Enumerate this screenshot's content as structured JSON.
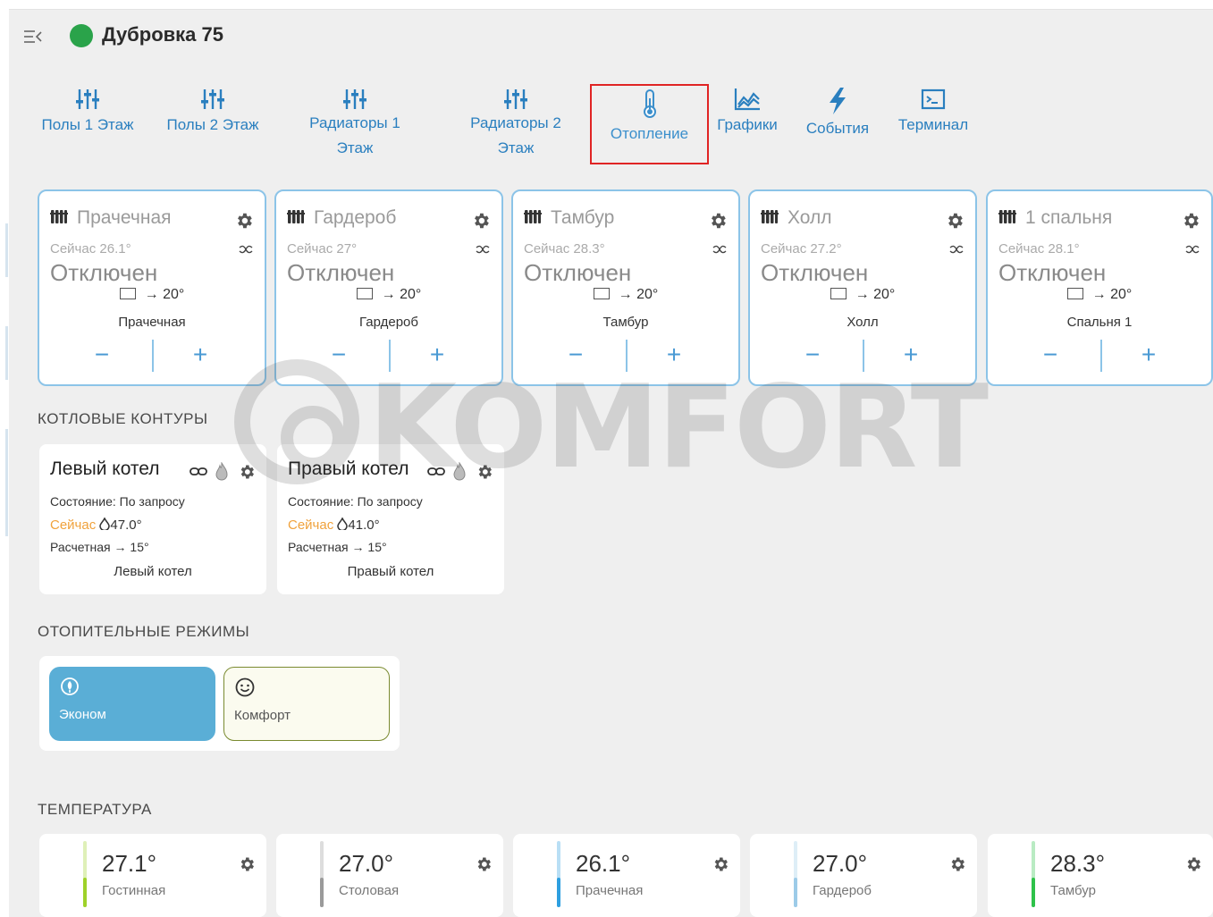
{
  "header": {
    "title": "Дубровка 75",
    "status_color": "#2aa34a"
  },
  "tabs": [
    {
      "label": "Полы 1 Этаж",
      "icon": "sliders-icon"
    },
    {
      "label": "Полы 2 Этаж",
      "icon": "sliders-icon"
    },
    {
      "label": "Радиаторы 1 Этаж",
      "icon": "sliders-icon"
    },
    {
      "label": "Радиаторы 2 Этаж",
      "icon": "sliders-icon"
    },
    {
      "label": "Отопление",
      "icon": "thermometer-icon",
      "active": true
    },
    {
      "label": "Графики",
      "icon": "chart-icon"
    },
    {
      "label": "События",
      "icon": "lightning-icon"
    },
    {
      "label": "Терминал",
      "icon": "terminal-icon"
    }
  ],
  "zones": [
    {
      "title": "Прачечная",
      "now": "Сейчас 26.1°",
      "state": "Отключен",
      "target": "20°",
      "name": "Прачечная"
    },
    {
      "title": "Гардероб",
      "now": "Сейчас 27°",
      "state": "Отключен",
      "target": "20°",
      "name": "Гардероб"
    },
    {
      "title": "Тамбур",
      "now": "Сейчас 28.3°",
      "state": "Отключен",
      "target": "20°",
      "name": "Тамбур"
    },
    {
      "title": "Холл",
      "now": "Сейчас 27.2°",
      "state": "Отключен",
      "target": "20°",
      "name": "Холл"
    },
    {
      "title": "1 спальня",
      "now": "Сейчас 28.1°",
      "state": "Отключен",
      "target": "20°",
      "name": "Спальня 1"
    }
  ],
  "zone_controls": {
    "minus": "−",
    "plus": "+",
    "arrow": "→"
  },
  "sections": {
    "boilers": "КОТЛОВЫЕ КОНТУРЫ",
    "modes": "ОТОПИТЕЛЬНЫЕ РЕЖИМЫ",
    "temperature": "ТЕМПЕРАТУРА"
  },
  "boilers": [
    {
      "title": "Левый котел",
      "state_label": "Состояние:",
      "state": "По запросу",
      "now_label": "Сейчас",
      "now": "47.0°",
      "calc_label": "Расчетная",
      "calc": "15°",
      "name": "Левый котел"
    },
    {
      "title": "Правый котел",
      "state_label": "Состояние:",
      "state": "По запросу",
      "now_label": "Сейчас",
      "now": "41.0°",
      "calc_label": "Расчетная",
      "calc": "15°",
      "name": "Правый котел"
    }
  ],
  "modes": [
    {
      "label": "Эконом",
      "icon": "leaf-circle-icon",
      "active": true
    },
    {
      "label": "Комфорт",
      "icon": "smile-icon",
      "active": false
    }
  ],
  "temperatures": [
    {
      "value": "27.1°",
      "label": "Гостинная",
      "color": "#9ed22a",
      "fill": 0.45
    },
    {
      "value": "27.0°",
      "label": "Столовая",
      "color": "#9a9a9a",
      "fill": 0.45
    },
    {
      "value": "26.1°",
      "label": "Прачечная",
      "color": "#2e9fe0",
      "fill": 0.45
    },
    {
      "value": "27.0°",
      "label": "Гардероб",
      "color": "#9ccbe8",
      "fill": 0.45
    },
    {
      "value": "28.3°",
      "label": "Тамбур",
      "color": "#2ec24a",
      "fill": 0.45
    }
  ],
  "colors": {
    "accent": "#2a7fbf",
    "card_border": "#8cc4e8",
    "active_tab_border": "#e02424",
    "now_label": "#f0a23c"
  }
}
